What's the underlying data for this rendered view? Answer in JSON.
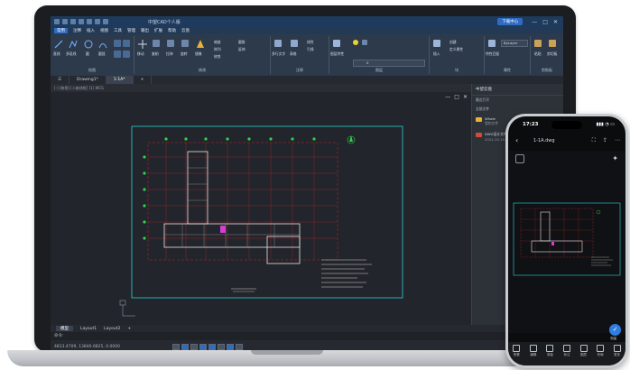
{
  "laptop": {
    "title_bar": {
      "title": "中望CAD个人版",
      "user_button": "下载中心",
      "win_controls": [
        "—",
        "□",
        "✕"
      ]
    },
    "menu": [
      "常用",
      "注释",
      "插入",
      "视图",
      "工具",
      "管理",
      "输出",
      "扩展",
      "帮助",
      "云盘"
    ],
    "menu_active_index": 0,
    "ribbon_groups": [
      {
        "label": "绘图"
      },
      {
        "label": "修改"
      },
      {
        "label": "注释"
      },
      {
        "label": "图层"
      },
      {
        "label": "块"
      },
      {
        "label": "属性"
      },
      {
        "label": "剪贴板"
      }
    ],
    "ribbon_texts": {
      "line": "直线",
      "polyline": "多段线",
      "circle": "圆",
      "arc": "圆弧",
      "move": "移动",
      "copy": "复制",
      "stretch": "拉伸",
      "rotate": "旋转",
      "mirror": "镜像",
      "scale": "缩放",
      "array": "阵列",
      "trim": "修剪",
      "fillet": "圆角",
      "extend": "延伸",
      "text": "多行文字",
      "table": "表格",
      "dim": "线性",
      "leader": "引线",
      "layer_props": "图层特性",
      "insert": "插入",
      "create": "创建",
      "define_attr": "定义属性",
      "match": "特性匹配",
      "paste": "粘贴",
      "clip": "剪切板",
      "layer_value": "0",
      "prop_bylayer": "ByLayer"
    },
    "doc_tabs": [
      "Drawing1*",
      "1-1A*"
    ],
    "doc_active_index": 1,
    "breadcrumb": "[-] [俯视] [二维线框] [1] WCS",
    "canvas_controls": [
      "—",
      "□",
      "✕"
    ],
    "right_panel": {
      "title": "中望云盘",
      "rows": [
        "最近打开",
        "全部文件"
      ],
      "file": {
        "name": "Whale",
        "subtitle": "我的文件"
      },
      "file2": {
        "name": "DWG设计文件",
        "subtitle": "2022-10-19 14:32"
      }
    },
    "layout_tabs": [
      "模型",
      "Layout1",
      "Layout2",
      "+"
    ],
    "layout_active_index": 0,
    "command_prompt": "命令:",
    "coords": "4813.4709, 13846.6825, 0.0000"
  },
  "phone": {
    "time": "17:23",
    "signal": "▮▮▮ ◔ ▭",
    "file_name": "1-1A.dwg",
    "fab_icon": "✓",
    "fab_label": "测量",
    "tools": [
      "快看",
      "编辑",
      "测量",
      "标注",
      "图层",
      "布局",
      "更多"
    ]
  }
}
